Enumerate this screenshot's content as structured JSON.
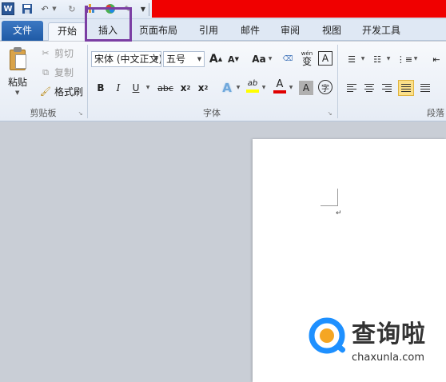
{
  "qat": {
    "app_icon": "W",
    "icons": [
      "save-icon",
      "undo-icon",
      "redo-icon",
      "customize-icon",
      "color-icon",
      "format-painter-icon",
      "qat-dropdown-icon"
    ]
  },
  "tabs": {
    "file": "文件",
    "home": "开始",
    "insert": "插入",
    "layout": "页面布局",
    "references": "引用",
    "mailings": "邮件",
    "review": "审阅",
    "view": "视图",
    "developer": "开发工具"
  },
  "clipboard": {
    "paste": "粘贴",
    "cut": "剪切",
    "copy": "复制",
    "format_painter": "格式刷",
    "label": "剪贴板"
  },
  "font": {
    "font_name": "宋体 (中文正文)",
    "font_size": "五号",
    "label": "字体",
    "grow": "A",
    "shrink": "A",
    "case": "Aa",
    "bold": "B",
    "italic": "I",
    "underline": "U",
    "strike": "abc",
    "subscript": "x",
    "superscript": "x",
    "text_effects": "A",
    "highlight": "ab",
    "font_color": "A",
    "char_shading": "A",
    "enclose": "字",
    "phonetic": "wén",
    "phonetic_char": "变",
    "border_char": "A"
  },
  "paragraph": {
    "label": "段落"
  },
  "watermark": {
    "cn": "查询啦",
    "en": "chaxunla.com"
  },
  "colors": {
    "title_bar": "#f00000",
    "highlight_box": "#7b3ea3",
    "file_tab": "#2b5797",
    "watermark_blue": "#1e90ff",
    "watermark_orange": "#f5a623"
  }
}
